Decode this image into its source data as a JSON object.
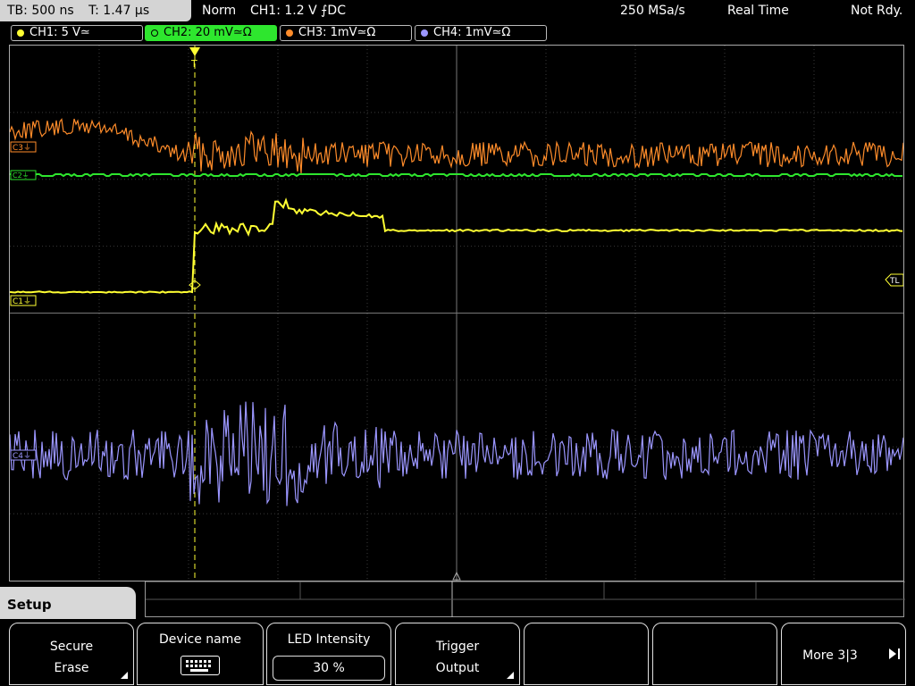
{
  "header": {
    "timebase": "TB: 500 ns",
    "trigger_time": "T: 1.47 µs",
    "mode": "Norm",
    "trigger_source": "CH1: 1.2 V ⨍DC",
    "sample_rate": "250 MSa/s",
    "acq_mode": "Real Time",
    "status": "Not Rdy."
  },
  "channels": [
    {
      "label": "CH1: 5 V≃",
      "color": "#ffff33"
    },
    {
      "label": "CH2: 20 mV≃Ω",
      "color": "#2ee62e",
      "active": true
    },
    {
      "label": "CH3: 1mV≃Ω",
      "color": "#ff8c2a"
    },
    {
      "label": "CH4: 1mV≃Ω",
      "color": "#9b96ff"
    }
  ],
  "markers": {
    "c3": "C3⏚",
    "c2": "C2⏚",
    "c1": "C1⏚",
    "c4": "C4⏚",
    "trigger_level": "TL",
    "trigger": "T"
  },
  "menu": {
    "setup_tab": "Setup",
    "softkeys": {
      "secure_erase": {
        "line1": "Secure",
        "line2": "Erase"
      },
      "device_name": {
        "title": "Device name",
        "icon": "keyboard-icon"
      },
      "led_intensity": {
        "title": "LED Intensity",
        "value": "30 %"
      },
      "trigger_output": {
        "line1": "Trigger",
        "line2": "Output"
      },
      "more": {
        "label": "More 3|3"
      }
    }
  },
  "colors": {
    "ch1": "#ffff33",
    "ch2": "#2ee62e",
    "ch3": "#ff8c2a",
    "ch4": "#9b96ff",
    "grid": "#555555"
  }
}
